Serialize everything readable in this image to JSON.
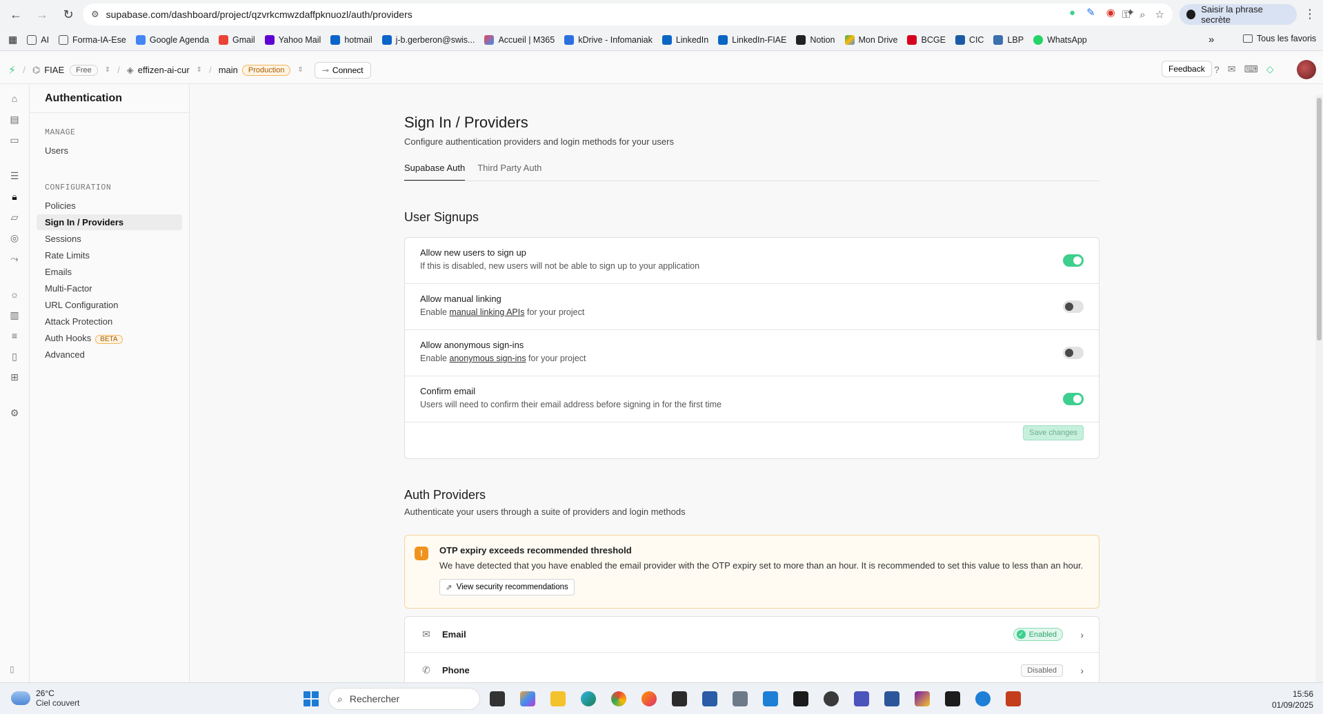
{
  "browser": {
    "url": "supabase.com/dashboard/project/qzvrkcmwzdaffpknuozl/auth/providers",
    "passphrase_label": "Saisir la phrase secrète",
    "bookmarks": [
      "AI",
      "Forma-IA-Ese",
      "Google Agenda",
      "Gmail",
      "Yahoo Mail",
      "hotmail",
      "j-b.gerberon@swis...",
      "Accueil | M365",
      "kDrive - Infomaniak",
      "LinkedIn",
      "LinkedIn-FIAE",
      "Notion",
      "Mon Drive",
      "BCGE",
      "CIC",
      "LBP",
      "WhatsApp"
    ],
    "all_bookmarks": "Tous les favoris"
  },
  "topbar": {
    "org": "FIAE",
    "plan": "Free",
    "project": "effizen-ai-cur",
    "branch": "main",
    "env": "Production",
    "connect": "Connect",
    "feedback": "Feedback"
  },
  "sidebar": {
    "title": "Authentication",
    "manage_label": "MANAGE",
    "manage_items": [
      "Users"
    ],
    "config_label": "CONFIGURATION",
    "config_items": [
      "Policies",
      "Sign In / Providers",
      "Sessions",
      "Rate Limits",
      "Emails",
      "Multi-Factor",
      "URL Configuration",
      "Attack Protection",
      "Auth Hooks",
      "Advanced"
    ],
    "beta": "BETA"
  },
  "main": {
    "title": "Sign In / Providers",
    "subtitle": "Configure authentication providers and login methods for your users",
    "tabs": [
      "Supabase Auth",
      "Third Party Auth"
    ],
    "signups": {
      "title": "User Signups",
      "rows": [
        {
          "title": "Allow new users to sign up",
          "desc": "If this is disabled, new users will not be able to sign up to your application",
          "on": true
        },
        {
          "title": "Allow manual linking",
          "desc_pre": "Enable ",
          "desc_link": "manual linking APIs",
          "desc_post": " for your project",
          "on": false
        },
        {
          "title": "Allow anonymous sign-ins",
          "desc_pre": "Enable ",
          "desc_link": "anonymous sign-ins",
          "desc_post": " for your project",
          "on": false
        },
        {
          "title": "Confirm email",
          "desc": "Users will need to confirm their email address before signing in for the first time",
          "on": true
        }
      ],
      "save": "Save changes"
    },
    "providers": {
      "title": "Auth Providers",
      "subtitle": "Authenticate your users through a suite of providers and login methods",
      "warning_title": "OTP expiry exceeds recommended threshold",
      "warning_text": "We have detected that you have enabled the email provider with the OTP expiry set to more than an hour. It is recommended to set this value to less than an hour.",
      "warning_button": "View security recommendations",
      "list": [
        {
          "name": "Email",
          "status": "Enabled"
        },
        {
          "name": "Phone",
          "status": "Disabled"
        }
      ]
    }
  },
  "taskbar": {
    "temp": "26°C",
    "weather": "Ciel couvert",
    "search": "Rechercher",
    "time": "15:56",
    "date": "01/09/2025"
  },
  "colors": {
    "brand_green": "#3ecf8e",
    "warning_orange": "#f0931e"
  }
}
